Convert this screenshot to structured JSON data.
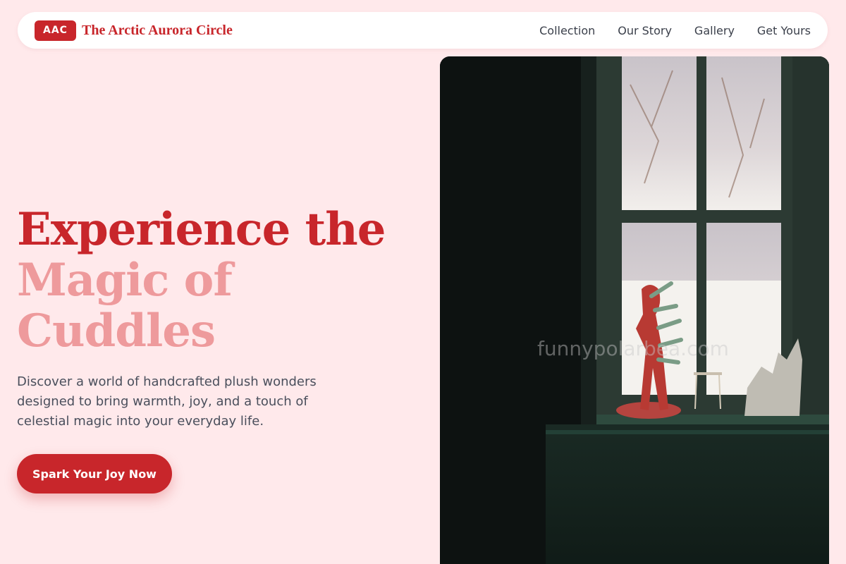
{
  "header": {
    "logo_badge": "AAC",
    "brand_name": "The Arctic Aurora Circle",
    "nav": [
      {
        "label": "Collection"
      },
      {
        "label": "Our Story"
      },
      {
        "label": "Gallery"
      },
      {
        "label": "Get Yours"
      }
    ]
  },
  "hero": {
    "title_line1": "Experience the",
    "title_line2": "Magic of",
    "title_line3": "Cuddles",
    "description": "Discover a world of handcrafted plush wonders designed to bring warmth, joy, and a touch of celestial magic into your everyday life.",
    "cta_label": "Spark Your Joy Now"
  },
  "image": {
    "watermark": "funnypolarbea.com"
  },
  "colors": {
    "background": "#ffe9eb",
    "accent": "#c8262b",
    "accent_light": "#ee9a9c",
    "text_muted": "#4a4f5c"
  }
}
